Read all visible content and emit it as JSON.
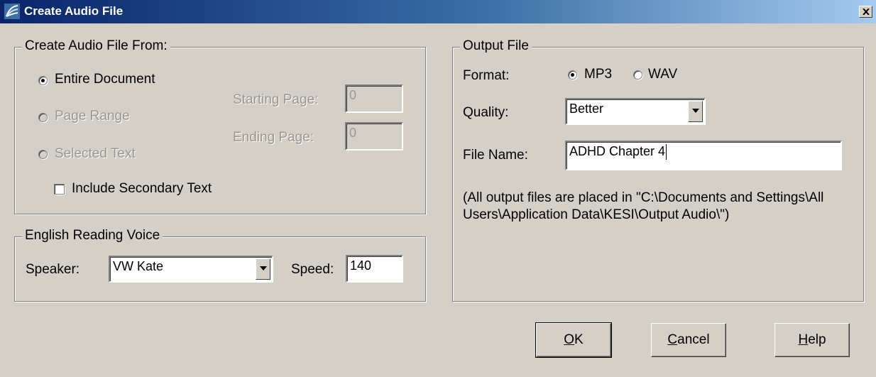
{
  "window": {
    "title": "Create Audio File",
    "icon": "speech-wave-icon",
    "close_label": "close-icon"
  },
  "source_group": {
    "legend": "Create Audio File From:",
    "options": [
      {
        "label": "Entire Document",
        "checked": true,
        "enabled": true
      },
      {
        "label": "Page Range",
        "checked": false,
        "enabled": false
      },
      {
        "label": "Selected Text",
        "checked": false,
        "enabled": false
      }
    ],
    "starting_page": {
      "label": "Starting Page:",
      "value": "0"
    },
    "ending_page": {
      "label": "Ending Page:",
      "value": "0"
    },
    "secondary": {
      "label": "Include Secondary Text",
      "checked": false
    }
  },
  "voice_group": {
    "legend": "English Reading Voice",
    "speaker_label": "Speaker:",
    "speaker_value": "VW Kate",
    "speed_label": "Speed:",
    "speed_value": "140"
  },
  "output_group": {
    "legend": "Output File",
    "format_label": "Format:",
    "formats": [
      {
        "label": "MP3",
        "checked": true
      },
      {
        "label": "WAV",
        "checked": false
      }
    ],
    "quality_label": "Quality:",
    "quality_value": "Better",
    "filename_label": "File Name:",
    "filename_value": "ADHD Chapter 4",
    "note": "(All output files are placed in \"C:\\Documents and Settings\\All Users\\Application Data\\KESI\\Output Audio\\\")"
  },
  "buttons": {
    "ok": {
      "mnemonic": "O",
      "rest": "K"
    },
    "cancel": {
      "mnemonic": "C",
      "rest": "ancel"
    },
    "help": {
      "mnemonic": "H",
      "rest": "elp"
    }
  }
}
